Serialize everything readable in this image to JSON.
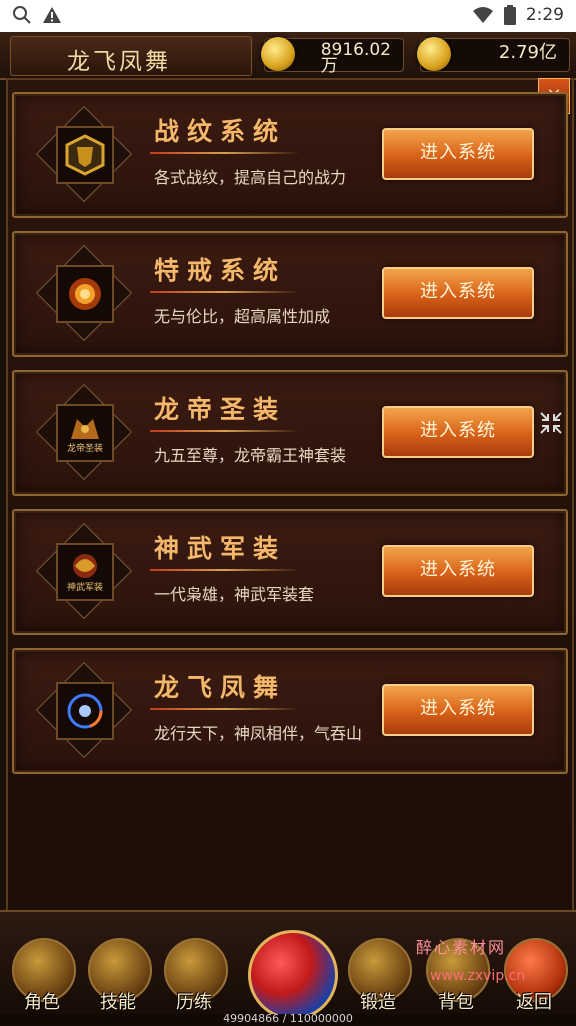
{
  "status_bar": {
    "time": "2:29"
  },
  "header": {
    "title": "龙飞凤舞",
    "currency1_value": "8916.02",
    "currency1_unit": "万",
    "currency2_value": "2.79亿"
  },
  "close_label": "×",
  "cards": [
    {
      "name": "战纹系统",
      "desc": "各式战纹，提高自己的战力",
      "button": "进入系统",
      "icon": "shield-emblem-icon"
    },
    {
      "name": "特戒系统",
      "desc": "无与伦比，超高属性加成",
      "button": "进入系统",
      "icon": "fire-ring-icon"
    },
    {
      "name": "龙帝圣装",
      "desc": "九五至尊，龙帝霸王神套装",
      "button": "进入系统",
      "icon": "dragon-armor-icon",
      "icon_text": "龙帝圣装"
    },
    {
      "name": "神武军装",
      "desc": "一代枭雄，神武军装套",
      "button": "进入系统",
      "icon": "war-armor-icon",
      "icon_text": "神武军装"
    },
    {
      "name": "龙飞凤舞",
      "desc": "龙行天下，神凤相伴，气吞山",
      "button": "进入系统",
      "icon": "phoenix-orb-icon"
    }
  ],
  "bottom_nav": [
    {
      "label": "角色",
      "icon": "character-icon"
    },
    {
      "label": "技能",
      "icon": "skill-book-icon"
    },
    {
      "label": "历练",
      "icon": "swords-icon"
    },
    {
      "label": "锻造",
      "icon": "forge-icon"
    },
    {
      "label": "背包",
      "icon": "bag-icon"
    },
    {
      "label": "返回",
      "icon": "return-icon"
    }
  ],
  "exp_text": "49904866 / 110000000",
  "watermark": {
    "line1": "醉心素材网",
    "line2": "www.zxvip.cn"
  },
  "colors": {
    "card_border": "#8d6631",
    "button_orange": "#d86119",
    "title_gold": "#f3b86c"
  }
}
